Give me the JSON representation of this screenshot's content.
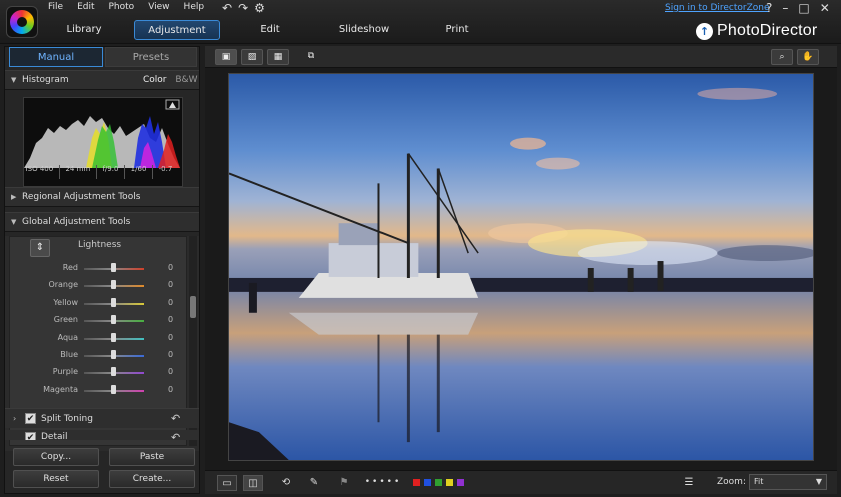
{
  "menu": [
    "File",
    "Edit",
    "Photo",
    "View",
    "Help"
  ],
  "modes": [
    {
      "label": "Library",
      "active": false
    },
    {
      "label": "Adjustment",
      "active": true
    },
    {
      "label": "Edit",
      "active": false
    },
    {
      "label": "Slideshow",
      "active": false
    },
    {
      "label": "Print",
      "active": false
    }
  ],
  "signin": "Sign in to DirectorZone",
  "window_controls": {
    "help": "?",
    "minimize": "–",
    "maximize": "□",
    "close": "✕"
  },
  "brand": "PhotoDirector",
  "panel": {
    "tabs": {
      "manual": "Manual",
      "presets": "Presets"
    },
    "histogram": {
      "title": "Histogram",
      "mode_color": "Color",
      "mode_bw": "B&W",
      "info": [
        "ISO 400",
        "24 mm",
        "f/9.0",
        "1/60",
        "-0.7"
      ]
    },
    "regional": "Regional Adjustment Tools",
    "global": "Global Adjustment Tools",
    "adjust": {
      "heading": "Lightness",
      "sliders": [
        {
          "label": "Red",
          "value": "0",
          "color": "#d0402a"
        },
        {
          "label": "Orange",
          "value": "0",
          "color": "#e08a2a"
        },
        {
          "label": "Yellow",
          "value": "0",
          "color": "#d8c838"
        },
        {
          "label": "Green",
          "value": "0",
          "color": "#48b040"
        },
        {
          "label": "Aqua",
          "value": "0",
          "color": "#40c0c0"
        },
        {
          "label": "Blue",
          "value": "0",
          "color": "#3a6ad8"
        },
        {
          "label": "Purple",
          "value": "0",
          "color": "#9048d0"
        },
        {
          "label": "Magenta",
          "value": "0",
          "color": "#d040b0"
        }
      ]
    },
    "split_toning": "Split Toning",
    "detail": "Detail",
    "buttons": {
      "copy": "Copy...",
      "paste": "Paste",
      "reset": "Reset",
      "create": "Create..."
    }
  },
  "bottom": {
    "label_colors": [
      "#e02020",
      "#2050e0",
      "#30a030",
      "#e0d020",
      "#9030d0"
    ],
    "zoom_label": "Zoom:",
    "zoom_value": "Fit"
  }
}
